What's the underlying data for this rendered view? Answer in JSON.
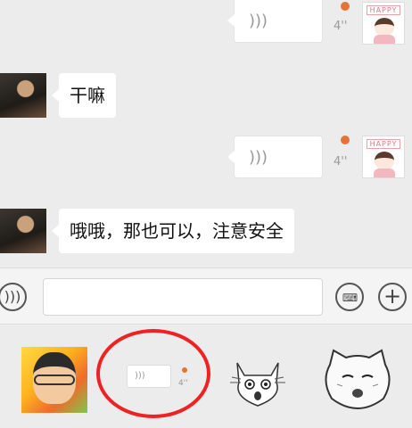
{
  "messages": [
    {
      "side": "right",
      "kind": "voice",
      "duration": "4''",
      "unread": true,
      "avatar_label": "HAPPY"
    },
    {
      "side": "left",
      "kind": "text",
      "text": "干嘛"
    },
    {
      "side": "right",
      "kind": "voice",
      "duration": "4''",
      "unread": true,
      "avatar_label": "HAPPY"
    },
    {
      "side": "left",
      "kind": "text",
      "text": "哦哦，那也可以，注意安全"
    }
  ],
  "input_bar": {
    "voice_icon": "voice-wave-icon",
    "text_value": "",
    "keyboard_icon": "keyboard-icon",
    "plus_icon": "plus-icon"
  },
  "sticker_panel": {
    "items": [
      {
        "name": "kid-glasses-sticker"
      },
      {
        "name": "voice-message-sticker",
        "duration": "4''"
      },
      {
        "name": "shocked-cat-sticker"
      },
      {
        "name": "round-face-sticker"
      }
    ],
    "highlight_color": "#e22222"
  },
  "colors": {
    "unread_dot": "#e47436",
    "bubble_bg": "#ffffff",
    "chat_bg": "#ececec"
  }
}
